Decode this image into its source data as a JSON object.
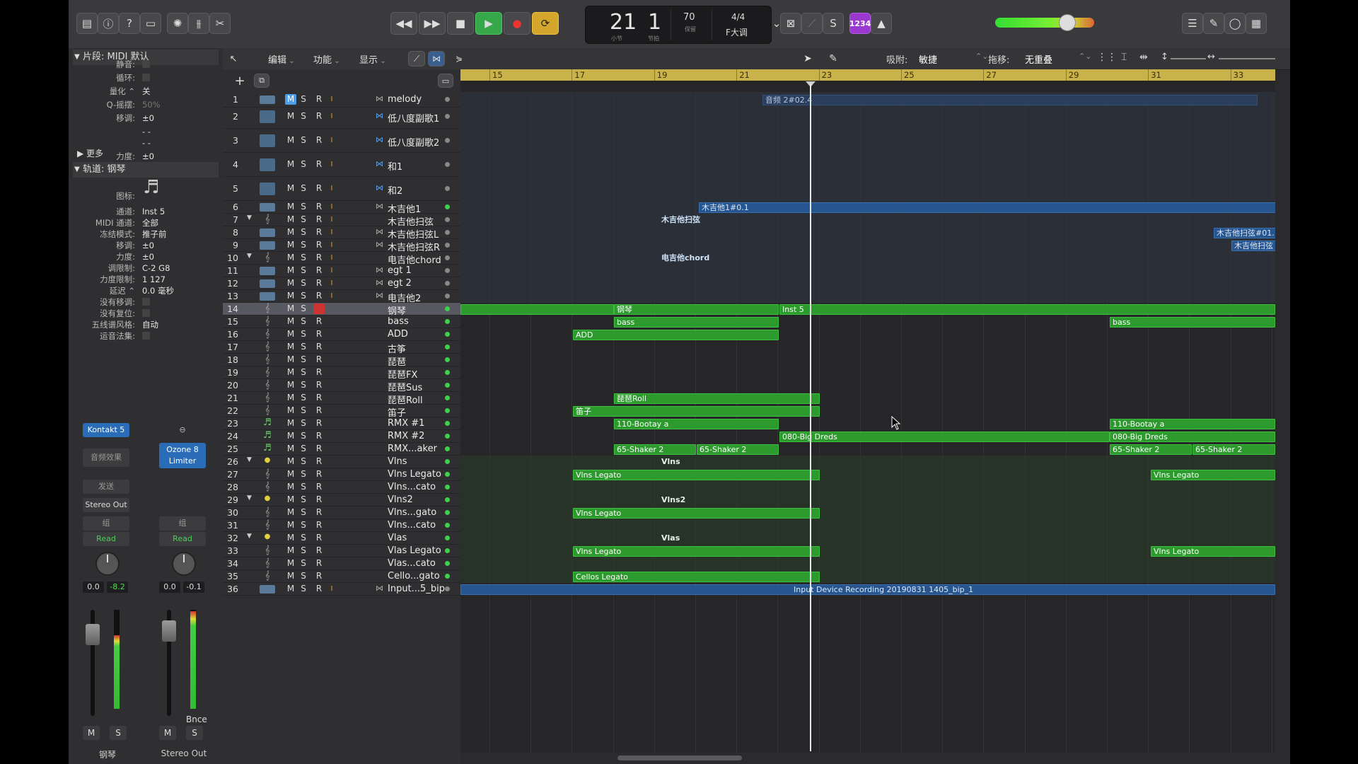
{
  "transport": {
    "bar": "21",
    "beat": "1",
    "bar_label": "小节",
    "beat_label": "节拍",
    "tempo": "70",
    "tempo_label": "保留",
    "timesig": "4/4",
    "key": "F大调",
    "count_in": "1234"
  },
  "editbar": {
    "menus": [
      "编辑",
      "功能",
      "显示"
    ],
    "snap_label": "吸附:",
    "snap_value": "敏捷",
    "drag_label": "拖移:",
    "drag_value": "无重叠"
  },
  "inspector": {
    "region_header": "片段: MIDI 默认",
    "region_rows": [
      {
        "label": "静音:",
        "value": ""
      },
      {
        "label": "循环:",
        "value": ""
      },
      {
        "label": "量化 ⌃",
        "value": "关"
      },
      {
        "label": "Q-摇摆:",
        "value": "50%"
      },
      {
        "label": "移调:",
        "value": "±0"
      },
      {
        "label": "",
        "value": "- -"
      },
      {
        "label": "",
        "value": "- -"
      },
      {
        "label": "力度:",
        "value": "±0"
      }
    ],
    "more_label": "▶ 更多",
    "track_header": "轨道: 钢琴",
    "icon_label": "图标:",
    "track_rows": [
      {
        "label": "通道:",
        "value": "Inst 5"
      },
      {
        "label": "MIDI 通道:",
        "value": "全部"
      },
      {
        "label": "冻结模式:",
        "value": "推子前"
      },
      {
        "label": "移调:",
        "value": "±0"
      },
      {
        "label": "力度:",
        "value": "±0"
      },
      {
        "label": "调限制:",
        "value": "C-2 G8"
      },
      {
        "label": "力度限制:",
        "value": "1 127"
      },
      {
        "label": "延迟 ⌃",
        "value": "0.0 毫秒"
      },
      {
        "label": "没有移调:",
        "value": ""
      },
      {
        "label": "没有复位:",
        "value": ""
      },
      {
        "label": "五线谱风格:",
        "value": "自动"
      },
      {
        "label": "运音法集:",
        "value": ""
      }
    ]
  },
  "strips": [
    {
      "plugin": "Kontakt 5",
      "fx": "音频效果",
      "send": "发送",
      "output": "Stereo Out",
      "group": "组",
      "automation": "Read",
      "pan": "0.0",
      "vol": "-8.2",
      "name": "钢琴",
      "bounce": ""
    },
    {
      "plugin": "Ozone 8 Limiter",
      "fx": "",
      "send": "",
      "output": "",
      "group": "组",
      "automation": "Read",
      "pan": "0.0",
      "vol": "-0.1",
      "name": "Stereo Out",
      "bounce": "Bnce"
    }
  ],
  "ruler": [
    "15",
    "17",
    "19",
    "21",
    "23",
    "25",
    "27",
    "29",
    "31",
    "33"
  ],
  "tracks": [
    {
      "n": "1",
      "name": "melody"
    },
    {
      "n": "2",
      "name": "低八度副歌1"
    },
    {
      "n": "3",
      "name": "低八度副歌2"
    },
    {
      "n": "4",
      "name": "和1"
    },
    {
      "n": "5",
      "name": "和2"
    },
    {
      "n": "6",
      "name": "木吉他1"
    },
    {
      "n": "7",
      "name": "木吉他扫弦"
    },
    {
      "n": "8",
      "name": "木吉他扫弦L"
    },
    {
      "n": "9",
      "name": "木吉他扫弦R"
    },
    {
      "n": "10",
      "name": "电吉他chord"
    },
    {
      "n": "11",
      "name": "egt 1"
    },
    {
      "n": "12",
      "name": "egt 2"
    },
    {
      "n": "13",
      "name": "电吉他2"
    },
    {
      "n": "14",
      "name": "钢琴"
    },
    {
      "n": "15",
      "name": "bass"
    },
    {
      "n": "16",
      "name": "ADD"
    },
    {
      "n": "17",
      "name": "古筝"
    },
    {
      "n": "18",
      "name": "琵琶"
    },
    {
      "n": "19",
      "name": "琵琶FX"
    },
    {
      "n": "20",
      "name": "琵琶Sus"
    },
    {
      "n": "21",
      "name": "琵琶Roll"
    },
    {
      "n": "22",
      "name": "笛子"
    },
    {
      "n": "23",
      "name": "RMX #1"
    },
    {
      "n": "24",
      "name": "RMX #2"
    },
    {
      "n": "25",
      "name": "RMX...aker"
    },
    {
      "n": "26",
      "name": "Vlns"
    },
    {
      "n": "27",
      "name": "Vlns Legato"
    },
    {
      "n": "28",
      "name": "Vlns...cato"
    },
    {
      "n": "29",
      "name": "Vlns2"
    },
    {
      "n": "30",
      "name": "Vlns...gato"
    },
    {
      "n": "31",
      "name": "Vlns...cato"
    },
    {
      "n": "32",
      "name": "Vlas"
    },
    {
      "n": "33",
      "name": "Vlas Legato"
    },
    {
      "n": "34",
      "name": "Vlas...cato"
    },
    {
      "n": "35",
      "name": "Cello...gato"
    },
    {
      "n": "36",
      "name": "Input...5_bip"
    }
  ],
  "regions": {
    "r1": "音频 2#02.4",
    "r6": "木吉他1#0.1",
    "r7": "木吉他扫弦",
    "r8": "木吉他扫弦#01.",
    "r9": "木吉他扫弦",
    "r10": "电吉他chord",
    "r14a": "钢琴",
    "r14b": "Inst 5",
    "r15a": "bass",
    "r15b": "bass",
    "r16": "ADD",
    "r21": "琵琶Roll",
    "r22": "笛子",
    "r23a": "110-Bootay a",
    "r23b": "110-Bootay a",
    "r24a": "080-Big Dreds",
    "r24b": "080-Big Dreds",
    "r25a": "65-Shaker 2",
    "r25b": "65-Shaker 2",
    "r25c": "65-Shaker 2",
    "r25d": "65-Shaker 2",
    "r26": "Vlns",
    "r27a": "Vlns Legato",
    "r27b": "Vlns Legato",
    "r29": "Vlns2",
    "r30": "Vlns Legato",
    "r32": "Vlas",
    "r33a": "Vlns Legato",
    "r33b": "Vlns Legato",
    "r35": "Cellos Legato",
    "r36": "Input Device Recording 20190831 1405_bip_1"
  },
  "colors": {
    "region_green": "#2c9a2c",
    "region_blue": "#26558f",
    "ruler": "#c9b24a",
    "play": "#36a84a",
    "cycle": "#d4a72c",
    "count_in": "#9a38d0"
  }
}
